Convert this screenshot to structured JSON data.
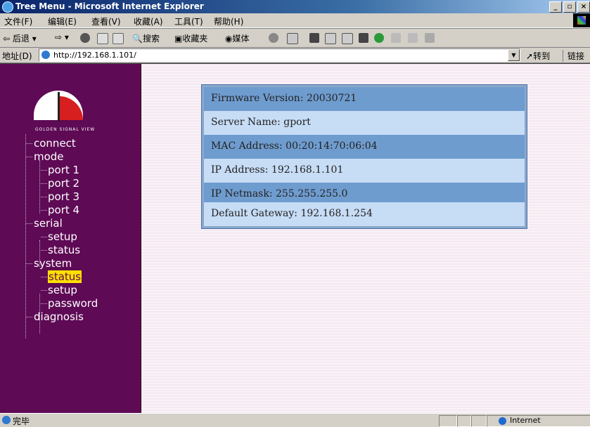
{
  "window": {
    "title": "Tree Menu - Microsoft Internet Explorer",
    "buttons": [
      "_",
      "b",
      "x"
    ]
  },
  "menu": [
    "文件(F)",
    "编辑(E)",
    "查看(V)",
    "收藏(A)",
    "工具(T)",
    "帮助(H)"
  ],
  "toolbar": {
    "back": "后退",
    "search": "搜索",
    "favorites": "收藏夹",
    "media": "媒体"
  },
  "address": {
    "label": "地址(D)",
    "url": "http://192.168.1.101/",
    "go": "转到",
    "links": "链接"
  },
  "sidebar": {
    "logo_text": "GOLDEN SIGNAL VIEW",
    "tree": [
      {
        "label": "connect",
        "level": 0
      },
      {
        "label": "mode",
        "level": 0
      },
      {
        "label": "port 1",
        "level": 1
      },
      {
        "label": "port 2",
        "level": 1
      },
      {
        "label": "port 3",
        "level": 1
      },
      {
        "label": "port 4",
        "level": 1
      },
      {
        "label": "serial",
        "level": 0
      },
      {
        "label": "setup",
        "level": 1
      },
      {
        "label": "status",
        "level": 1
      },
      {
        "label": "system",
        "level": 0
      },
      {
        "label": "status",
        "level": 1,
        "selected": true
      },
      {
        "label": "setup",
        "level": 1
      },
      {
        "label": "password",
        "level": 1
      },
      {
        "label": "diagnosis",
        "level": 0
      }
    ]
  },
  "info": {
    "firmware": "Firmware Version: 20030721",
    "server_name": "Server Name: gport",
    "mac": "MAC Address: 00:20:14:70:06:04",
    "ip": "IP Address: 192.168.1.101",
    "netmask": "IP Netmask: 255.255.255.0",
    "gateway": "Default Gateway: 192.168.1.254"
  },
  "status": {
    "text": "完毕",
    "zone": "Internet"
  },
  "colors": {
    "sidebar_bg": "#5e0a55",
    "selected_bg": "#ffe000",
    "row_dark": "#6f9ccf",
    "row_light": "#c7dcf5"
  }
}
